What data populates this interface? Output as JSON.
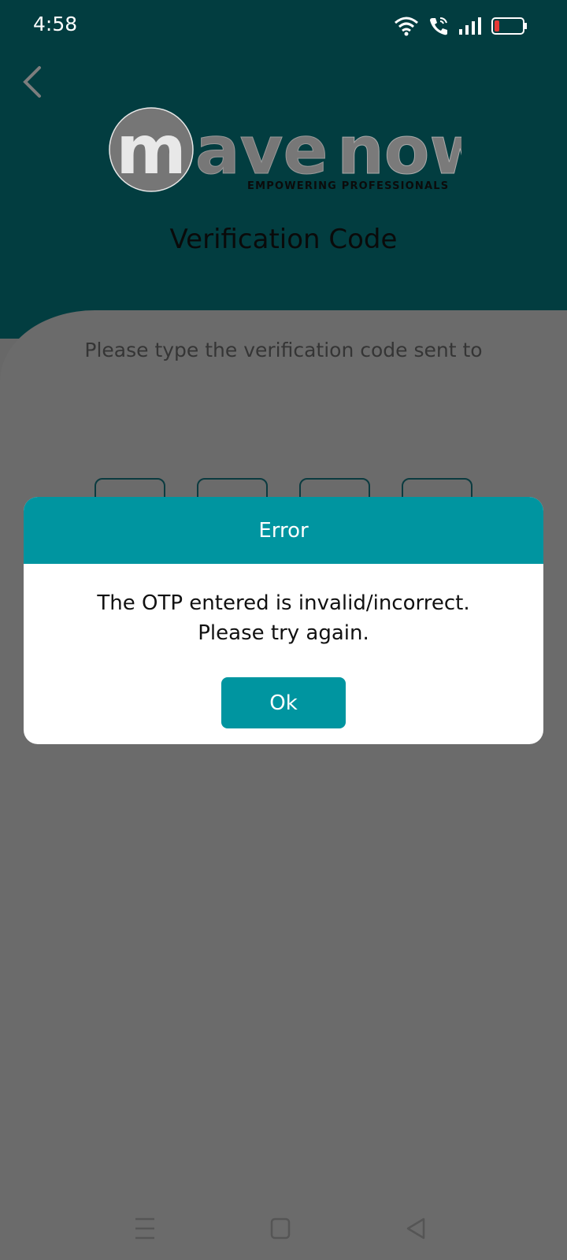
{
  "status_bar": {
    "time": "4:58",
    "icons": [
      "wifi-icon",
      "wifi-calling-icon",
      "signal-icon",
      "battery-low-icon"
    ]
  },
  "header": {
    "back_icon": "chevron-left-icon",
    "logo_text": "mavenow",
    "logo_tagline": "Empowering Professionals",
    "title": "Verification Code"
  },
  "content": {
    "instruction": "Please type the verification code sent to",
    "otp_box_count": 4
  },
  "dialog": {
    "title": "Error",
    "message_line1": "The OTP entered is invalid/incorrect.",
    "message_line2": "Please try again.",
    "ok_label": "Ok"
  },
  "nav_bar": {
    "icons": [
      "menu-icon",
      "home-icon",
      "back-icon"
    ]
  },
  "colors": {
    "header_bg": "#023d40",
    "accent": "#0095a0",
    "overlay": "#686868"
  }
}
